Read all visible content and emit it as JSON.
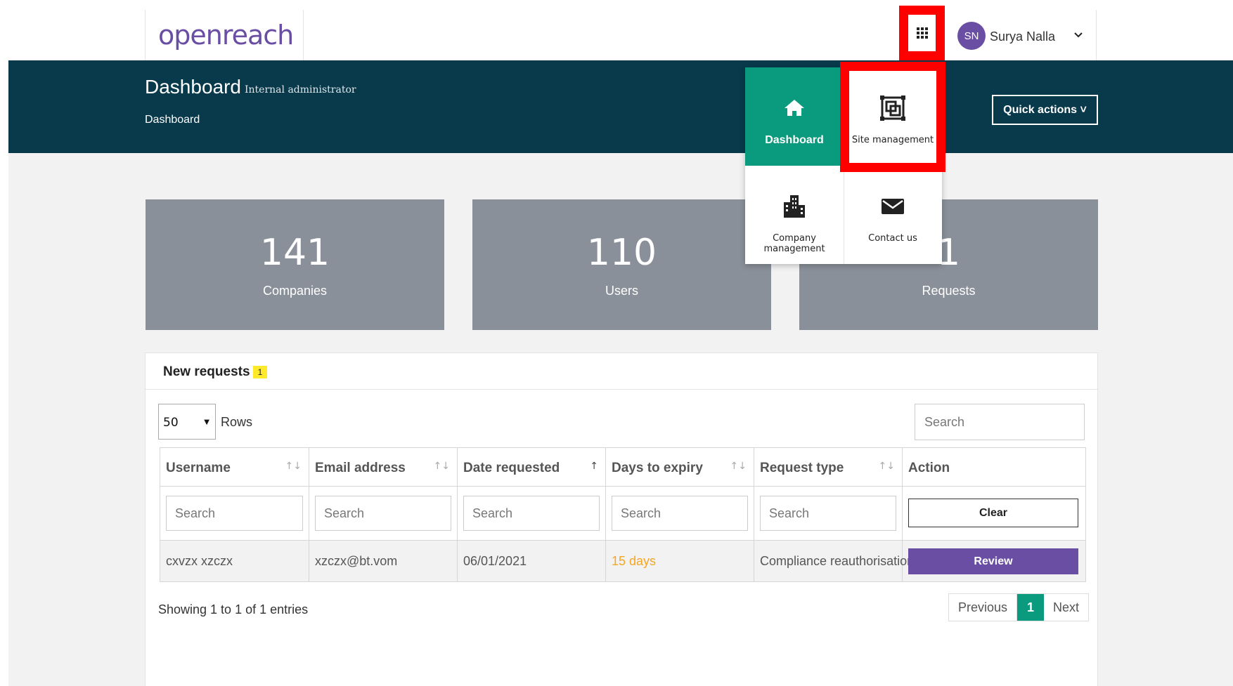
{
  "brand": {
    "logo_text": "openreach"
  },
  "header": {
    "user_initials": "SN",
    "user_name": "Surya Nalla"
  },
  "hero": {
    "title": "Dashboard",
    "subtitle": "Internal administrator",
    "breadcrumb": "Dashboard",
    "quick_actions_label": "Quick actions ˅"
  },
  "app_menu": {
    "items": [
      {
        "label": "Dashboard",
        "icon": "home-icon",
        "active": true
      },
      {
        "label": "Site management",
        "icon": "site-management-icon",
        "active": false
      },
      {
        "label": "Company management",
        "icon": "building-icon",
        "active": false
      },
      {
        "label": "Contact us",
        "icon": "envelope-icon",
        "active": false
      }
    ]
  },
  "stats": [
    {
      "value": "141",
      "label": "Companies"
    },
    {
      "value": "110",
      "label": "Users"
    },
    {
      "value": "1",
      "label": "Requests"
    }
  ],
  "requests_panel": {
    "title": "New requests",
    "badge": "1",
    "rows_value": "50",
    "rows_label": "Rows",
    "search_placeholder": "Search",
    "columns": [
      {
        "label": "Username"
      },
      {
        "label": "Email address"
      },
      {
        "label": "Date requested"
      },
      {
        "label": "Days to expiry"
      },
      {
        "label": "Request type"
      },
      {
        "label": "Action"
      }
    ],
    "filter_placeholder": "Search",
    "clear_label": "Clear",
    "rows": [
      {
        "username": "cxvzx xzczx",
        "email": "xzczx@bt.vom",
        "date_requested": "06/01/2021",
        "days_to_expiry": "15 days",
        "request_type": "Compliance reauthorisation",
        "action_label": "Review"
      }
    ],
    "showing_text": "Showing 1 to 1 of 1 entries",
    "pagination": {
      "previous": "Previous",
      "current_page": "1",
      "next": "Next"
    }
  },
  "colors": {
    "brand_purple": "#6a4ea3",
    "hero_bg": "#083a4b",
    "accent_green": "#0a9a7d",
    "warning": "#f5a623",
    "highlight_red": "#ff0000",
    "stat_bg": "#8a9099"
  }
}
